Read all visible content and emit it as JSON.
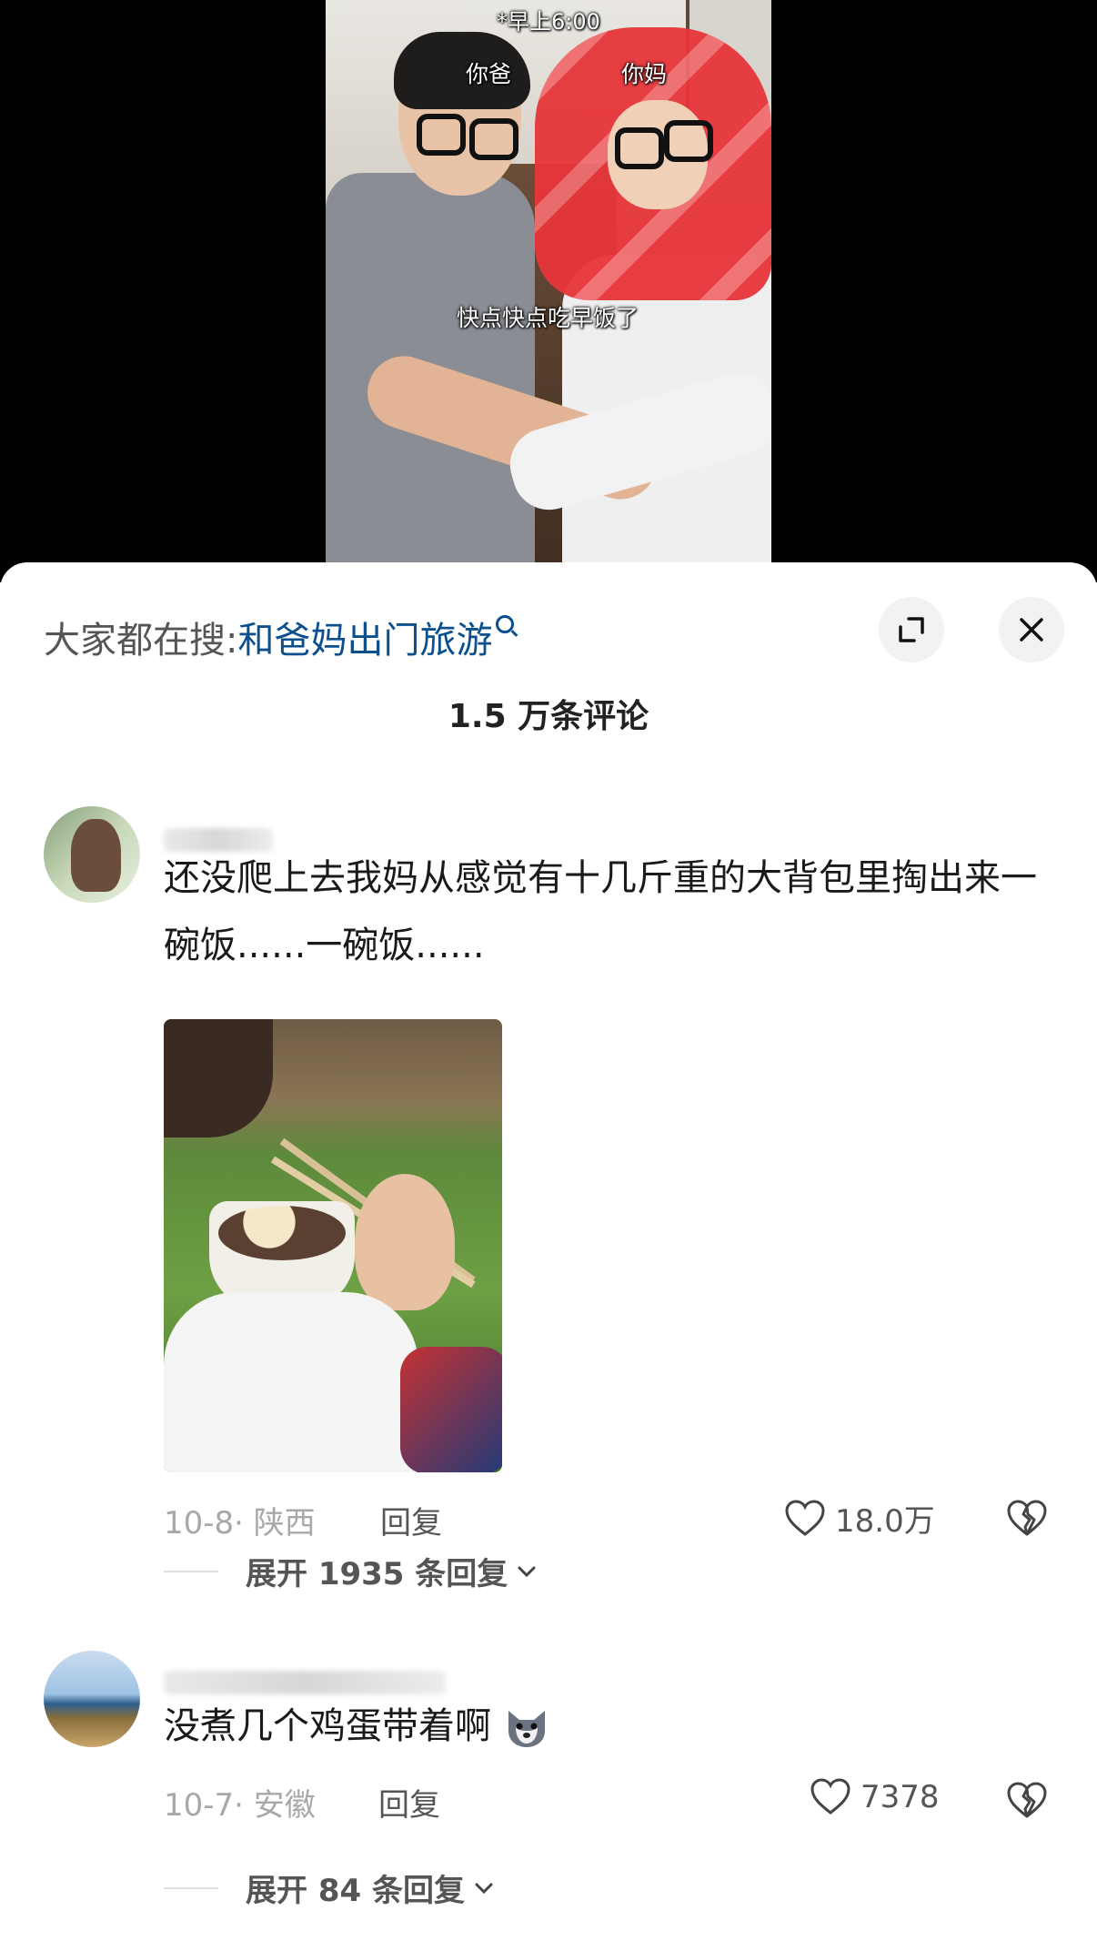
{
  "video": {
    "time_caption": "*早上6:00",
    "left_label": "你爸",
    "right_label": "你妈",
    "subtitle": "快点快点吃早饭了"
  },
  "sheet": {
    "search_label": "大家都在搜:",
    "search_query": "和爸妈出门旅游",
    "comment_count": "1.5 万条评论"
  },
  "comments": [
    {
      "text": "还没爬上去我妈从感觉有十几斤重的大背包里掏出来一碗饭......一碗饭......",
      "date": "10-8",
      "location": "陕西",
      "reply_label": "回复",
      "likes": "18.0万",
      "expand_label": "展开 1935 条回复"
    },
    {
      "text": "没煮几个鸡蛋带着啊",
      "date": "10-7",
      "location": "安徽",
      "reply_label": "回复",
      "likes": "7378",
      "expand_label": "展开 84 条回复"
    }
  ],
  "icons": {
    "expand": "expand-icon",
    "close": "close-icon",
    "like": "heart-icon",
    "dislike": "broken-heart-icon",
    "chevron": "chevron-down-icon",
    "emoji": "wolf-emoji-icon"
  },
  "colors": {
    "link": "#0b4f8c",
    "meta": "#a8a8a8",
    "text": "#1a1a1a"
  }
}
